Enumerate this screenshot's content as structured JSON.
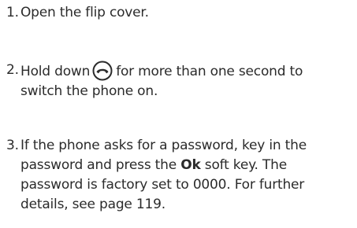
{
  "steps": [
    {
      "number": "1.",
      "line1": "Open the flip cover."
    },
    {
      "number": "2.",
      "line1_before_icon": "Hold down",
      "icon": "end-call-key-icon",
      "line1_after_icon": "for more than one second to",
      "line2": "switch the phone on."
    },
    {
      "number": "3.",
      "line1": "If the phone asks for a password, key in the",
      "line2_before_key": "password and press the",
      "soft_key_label": "Ok",
      "line2_after_key": "soft key. The",
      "line3": "password is factory set to 0000. For further",
      "line4": "details, see page 119."
    }
  ]
}
